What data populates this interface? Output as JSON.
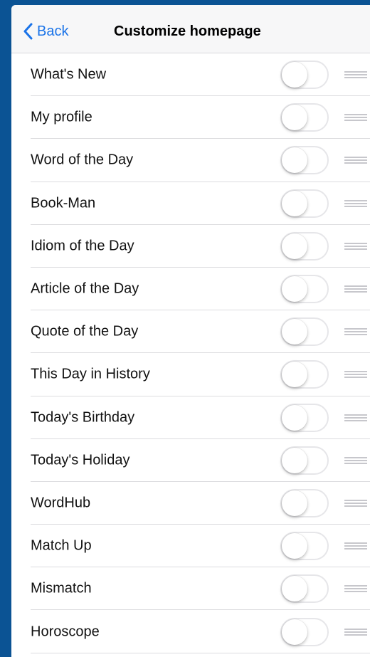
{
  "nav": {
    "back_label": "Back",
    "title": "Customize homepage"
  },
  "colors": {
    "accent": "#1a73e8",
    "frame": "#0b5394"
  },
  "items": [
    {
      "label": "What's New",
      "enabled": false
    },
    {
      "label": "My profile",
      "enabled": false
    },
    {
      "label": "Word of the Day",
      "enabled": false
    },
    {
      "label": "Book-Man",
      "enabled": false
    },
    {
      "label": "Idiom of the Day",
      "enabled": false
    },
    {
      "label": "Article of the Day",
      "enabled": false
    },
    {
      "label": "Quote of the Day",
      "enabled": false
    },
    {
      "label": "This Day in History",
      "enabled": false
    },
    {
      "label": "Today's Birthday",
      "enabled": false
    },
    {
      "label": "Today's Holiday",
      "enabled": false
    },
    {
      "label": "WordHub",
      "enabled": false
    },
    {
      "label": "Match Up",
      "enabled": false
    },
    {
      "label": "Mismatch",
      "enabled": false
    },
    {
      "label": "Horoscope",
      "enabled": false
    }
  ]
}
